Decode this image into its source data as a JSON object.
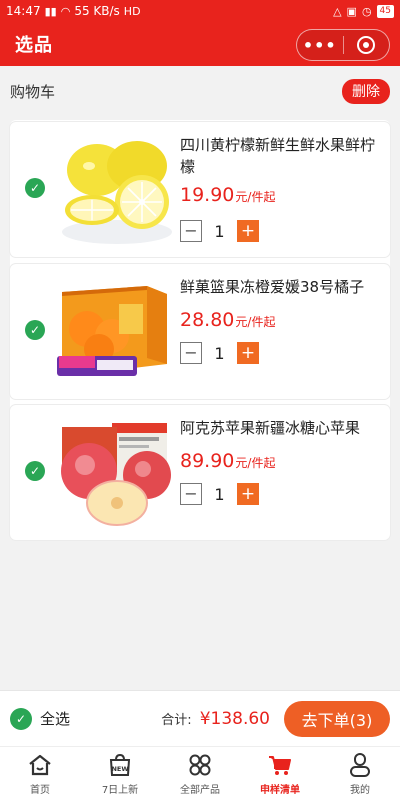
{
  "status_bar": {
    "time": "14:47",
    "network": "55 KB/s",
    "hd": "HD",
    "battery": "45"
  },
  "header": {
    "title": "选品"
  },
  "cart": {
    "title": "购物车",
    "delete_label": "删除",
    "items": [
      {
        "name": "四川黄柠檬新鲜生鲜水果鲜柠檬",
        "price": "19.90",
        "unit": "元/件起",
        "qty": "1"
      },
      {
        "name": "鲜菓篮果冻橙爱媛38号橘子",
        "price": "28.80",
        "unit": "元/件起",
        "qty": "1"
      },
      {
        "name": "阿克苏苹果新疆冰糖心苹果",
        "price": "89.90",
        "unit": "元/件起",
        "qty": "1"
      }
    ]
  },
  "footer": {
    "select_all": "全选",
    "total_label": "合计:",
    "total_value": "¥138.60",
    "checkout": "去下单(3)"
  },
  "tabs": [
    {
      "label": "首页",
      "icon": "home-icon"
    },
    {
      "label": "7日上新",
      "icon": "new-bag-icon"
    },
    {
      "label": "全部产品",
      "icon": "grid-icon"
    },
    {
      "label": "申样清单",
      "icon": "cart-icon",
      "active": true
    },
    {
      "label": "我的",
      "icon": "person-icon"
    }
  ],
  "colors": {
    "brand_red": "#e8231d",
    "accent_orange": "#ee5f25",
    "check_green": "#2aa655"
  }
}
